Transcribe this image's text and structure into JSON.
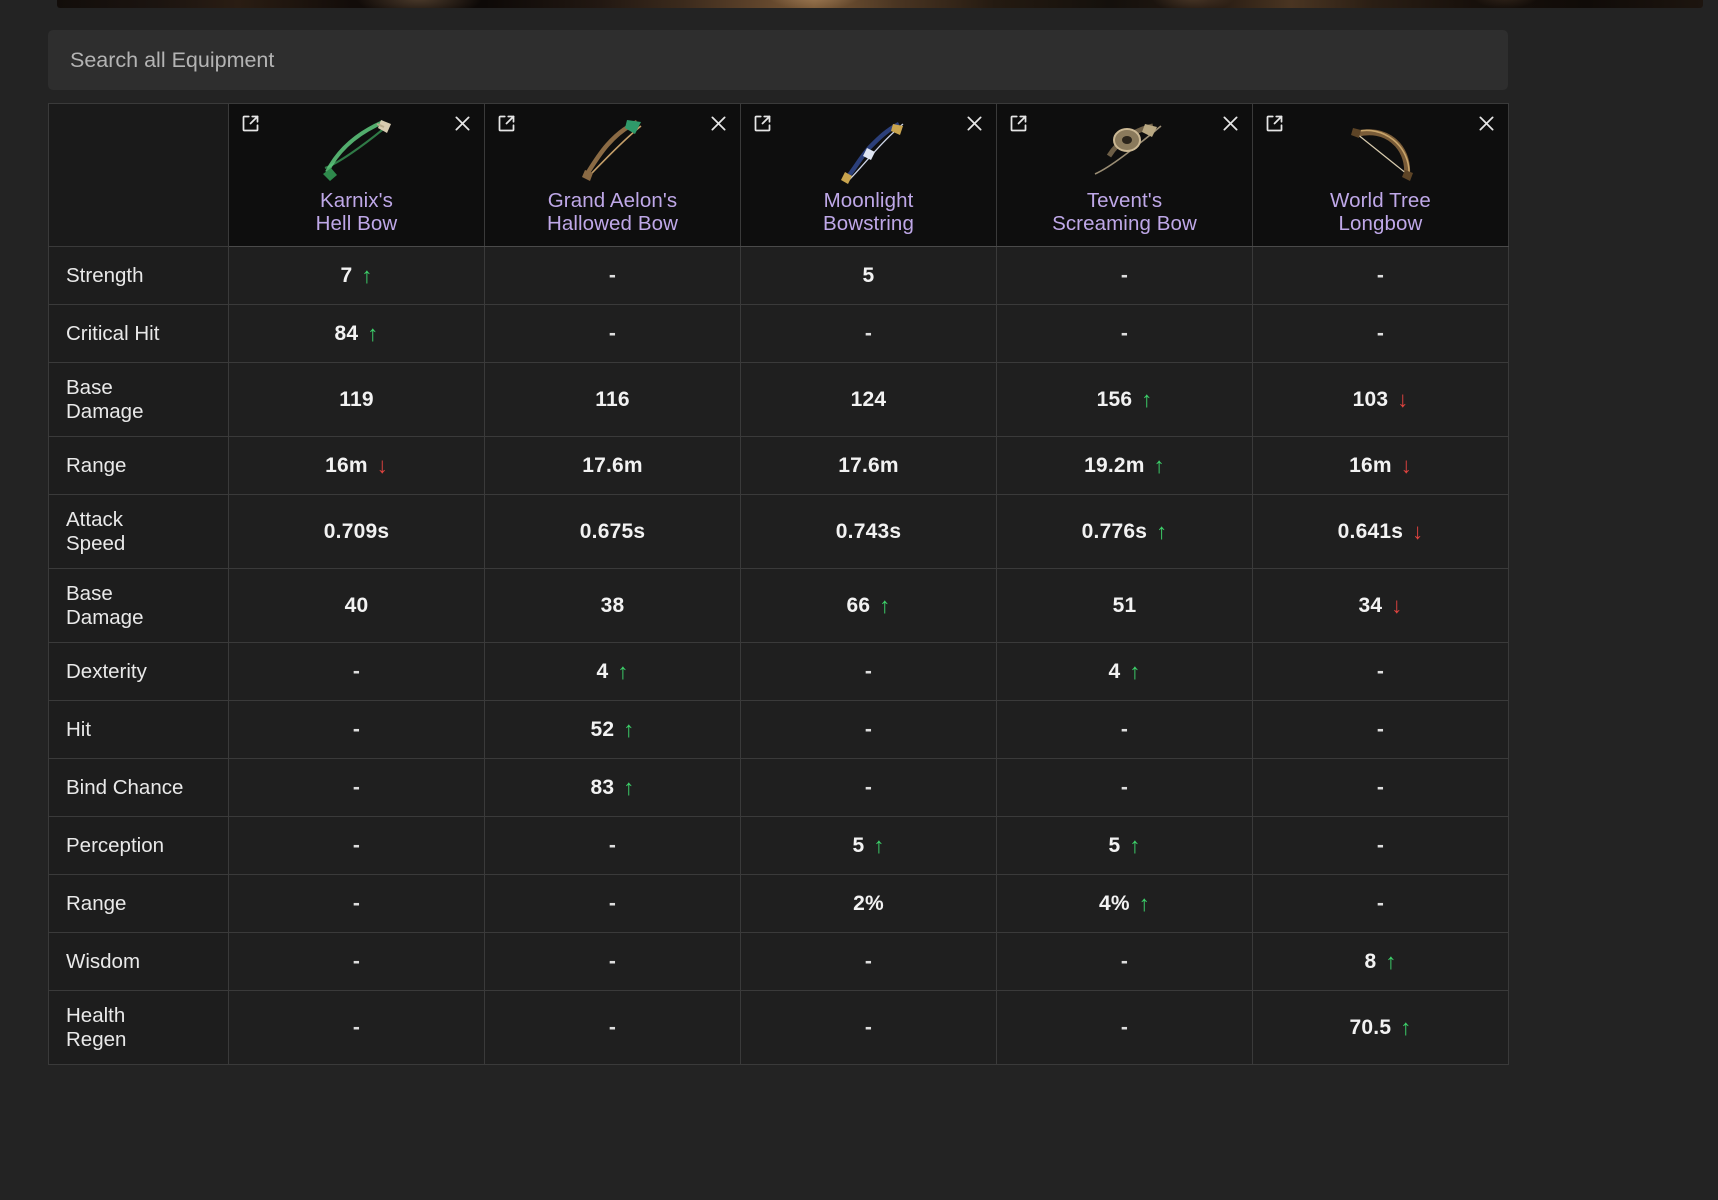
{
  "banner": {
    "name": "hero-banner-image"
  },
  "search": {
    "placeholder": "Search all Equipment",
    "value": ""
  },
  "colors": {
    "item_name": "#bfa8e8",
    "arrow_up": "#3dd16a",
    "arrow_down": "#e0433f",
    "cell_text": "#f2f2f2",
    "page_background": "#232323"
  },
  "icons": {
    "external_link": "external-link-icon",
    "close": "close-icon",
    "arrow_up": "arrow-up-icon",
    "arrow_down": "arrow-down-icon"
  },
  "table": {
    "label_column_header": "",
    "items": [
      {
        "name": "Karnix's\nHell Bow",
        "thumb": "karnixs-hell-bow-thumbnail"
      },
      {
        "name": "Grand Aelon's\nHallowed Bow",
        "thumb": "grand-aelons-hallowed-bow-thumbnail"
      },
      {
        "name": "Moonlight\nBowstring",
        "thumb": "moonlight-bowstring-thumbnail"
      },
      {
        "name": "Tevent's\nScreaming Bow",
        "thumb": "tevents-screaming-bow-thumbnail"
      },
      {
        "name": "World Tree\nLongbow",
        "thumb": "world-tree-longbow-thumbnail"
      }
    ],
    "rows": [
      {
        "label": "Strength",
        "tall": false,
        "cells": [
          {
            "value": "7",
            "arrow": "up"
          },
          {
            "value": "-",
            "arrow": ""
          },
          {
            "value": "5",
            "arrow": ""
          },
          {
            "value": "-",
            "arrow": ""
          },
          {
            "value": "-",
            "arrow": ""
          }
        ]
      },
      {
        "label": "Critical Hit",
        "tall": false,
        "cells": [
          {
            "value": "84",
            "arrow": "up"
          },
          {
            "value": "-",
            "arrow": ""
          },
          {
            "value": "-",
            "arrow": ""
          },
          {
            "value": "-",
            "arrow": ""
          },
          {
            "value": "-",
            "arrow": ""
          }
        ]
      },
      {
        "label": "Base\nDamage",
        "tall": true,
        "cells": [
          {
            "value": "119",
            "arrow": ""
          },
          {
            "value": "116",
            "arrow": ""
          },
          {
            "value": "124",
            "arrow": ""
          },
          {
            "value": "156",
            "arrow": "up"
          },
          {
            "value": "103",
            "arrow": "down"
          }
        ]
      },
      {
        "label": "Range",
        "tall": false,
        "cells": [
          {
            "value": "16m",
            "arrow": "down"
          },
          {
            "value": "17.6m",
            "arrow": ""
          },
          {
            "value": "17.6m",
            "arrow": ""
          },
          {
            "value": "19.2m",
            "arrow": "up"
          },
          {
            "value": "16m",
            "arrow": "down"
          }
        ]
      },
      {
        "label": "Attack\nSpeed",
        "tall": true,
        "cells": [
          {
            "value": "0.709s",
            "arrow": ""
          },
          {
            "value": "0.675s",
            "arrow": ""
          },
          {
            "value": "0.743s",
            "arrow": ""
          },
          {
            "value": "0.776s",
            "arrow": "up"
          },
          {
            "value": "0.641s",
            "arrow": "down"
          }
        ]
      },
      {
        "label": "Base\nDamage",
        "tall": true,
        "cells": [
          {
            "value": "40",
            "arrow": ""
          },
          {
            "value": "38",
            "arrow": ""
          },
          {
            "value": "66",
            "arrow": "up"
          },
          {
            "value": "51",
            "arrow": ""
          },
          {
            "value": "34",
            "arrow": "down"
          }
        ]
      },
      {
        "label": "Dexterity",
        "tall": false,
        "cells": [
          {
            "value": "-",
            "arrow": ""
          },
          {
            "value": "4",
            "arrow": "up"
          },
          {
            "value": "-",
            "arrow": ""
          },
          {
            "value": "4",
            "arrow": "up"
          },
          {
            "value": "-",
            "arrow": ""
          }
        ]
      },
      {
        "label": "Hit",
        "tall": false,
        "cells": [
          {
            "value": "-",
            "arrow": ""
          },
          {
            "value": "52",
            "arrow": "up"
          },
          {
            "value": "-",
            "arrow": ""
          },
          {
            "value": "-",
            "arrow": ""
          },
          {
            "value": "-",
            "arrow": ""
          }
        ]
      },
      {
        "label": "Bind Chance",
        "tall": false,
        "cells": [
          {
            "value": "-",
            "arrow": ""
          },
          {
            "value": "83",
            "arrow": "up"
          },
          {
            "value": "-",
            "arrow": ""
          },
          {
            "value": "-",
            "arrow": ""
          },
          {
            "value": "-",
            "arrow": ""
          }
        ]
      },
      {
        "label": "Perception",
        "tall": false,
        "cells": [
          {
            "value": "-",
            "arrow": ""
          },
          {
            "value": "-",
            "arrow": ""
          },
          {
            "value": "5",
            "arrow": "up"
          },
          {
            "value": "5",
            "arrow": "up"
          },
          {
            "value": "-",
            "arrow": ""
          }
        ]
      },
      {
        "label": "Range",
        "tall": false,
        "cells": [
          {
            "value": "-",
            "arrow": ""
          },
          {
            "value": "-",
            "arrow": ""
          },
          {
            "value": "2%",
            "arrow": ""
          },
          {
            "value": "4%",
            "arrow": "up"
          },
          {
            "value": "-",
            "arrow": ""
          }
        ]
      },
      {
        "label": "Wisdom",
        "tall": false,
        "cells": [
          {
            "value": "-",
            "arrow": ""
          },
          {
            "value": "-",
            "arrow": ""
          },
          {
            "value": "-",
            "arrow": ""
          },
          {
            "value": "-",
            "arrow": ""
          },
          {
            "value": "8",
            "arrow": "up"
          }
        ]
      },
      {
        "label": "Health\nRegen",
        "tall": true,
        "cells": [
          {
            "value": "-",
            "arrow": ""
          },
          {
            "value": "-",
            "arrow": ""
          },
          {
            "value": "-",
            "arrow": ""
          },
          {
            "value": "-",
            "arrow": ""
          },
          {
            "value": "70.5",
            "arrow": "up"
          }
        ]
      }
    ]
  }
}
